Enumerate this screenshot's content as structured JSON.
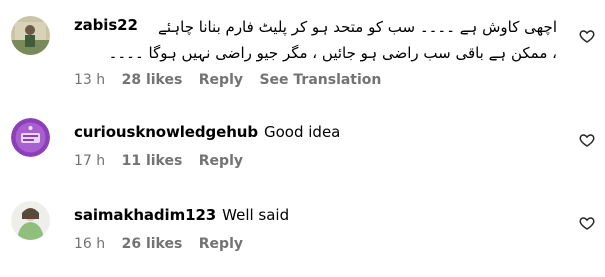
{
  "comments": [
    {
      "username": "zabis22",
      "text_line1": "اچھی کاوش ہے ۔۔۔۔ سب کو متحد ہو کر پلیٹ فارم بنانا چاہئے",
      "text_line2": "، ممکن ہے باقی سب راضی ہو جائیں ، مگر جیو راضی نہیں ہوگا ۔۔۔۔",
      "time": "13 h",
      "likes": "28 likes",
      "reply": "Reply",
      "translate": "See Translation",
      "avatar_icon": "profile-photo-icon"
    },
    {
      "username": "curiousknowledgehub",
      "text": "Good idea",
      "time": "17 h",
      "likes": "11 likes",
      "reply": "Reply",
      "avatar_icon": "purple-logo-icon"
    },
    {
      "username": "saimakhadim123",
      "text": "Well said",
      "time": "16 h",
      "likes": "26 likes",
      "reply": "Reply",
      "avatar_icon": "profile-photo-icon"
    }
  ],
  "colors": {
    "meta": "#737373",
    "text": "#000000",
    "avatar2": "#8b3fb8"
  },
  "like_icon": "heart-outline-icon"
}
